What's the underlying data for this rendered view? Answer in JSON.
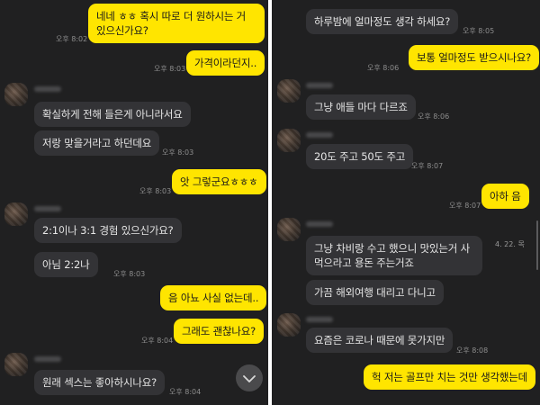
{
  "left": {
    "messages": [
      {
        "sender": "me",
        "text": "네네 ㅎㅎ 혹시 따로 더 원하시는 거 있으신가요?",
        "time": "오후 8:02"
      },
      {
        "sender": "me",
        "text": "가격이라던지..",
        "time": "오후 8:03"
      },
      {
        "sender": "other",
        "text": "확실하게 전해 들은게 아니라서요"
      },
      {
        "sender": "other",
        "text": "저랑 맞을거라고 하던데요",
        "time": "오후 8:03"
      },
      {
        "sender": "me",
        "text": "앗 그렇군요ㅎㅎㅎ",
        "time": "오후 8:03"
      },
      {
        "sender": "other",
        "text": "2:1이나 3:1 경험 있으신가요?"
      },
      {
        "sender": "other",
        "text": "아님  2:2나",
        "time": "오후 8:03"
      },
      {
        "sender": "me",
        "text": "음 아뇨 사실 없는데..",
        "time": ""
      },
      {
        "sender": "me",
        "text": "그래도 괜찮나요?",
        "time": "오후 8:04"
      },
      {
        "sender": "other",
        "text": "원래 섹스는 좋아하시나요?",
        "time": "오후 8:04"
      }
    ]
  },
  "right": {
    "messages": [
      {
        "sender": "other",
        "text": "하루밤에 얼마정도 생각 하세요?",
        "time": "오후 8:05"
      },
      {
        "sender": "me",
        "text": "보통 얼마정도 받으시나요?",
        "time": "오후 8:06"
      },
      {
        "sender": "other",
        "text": "그냥 애들 마다 다르죠",
        "time": "오후 8:06"
      },
      {
        "sender": "other",
        "text": "20도 주고 50도 주고",
        "time": "오후 8:07"
      },
      {
        "sender": "me",
        "text": "아하 음",
        "time": "오후 8:07"
      },
      {
        "sender": "other",
        "text": "그냥 차비랑  수고 했으니  맛있는거 사먹으라고 용돈 주는거죠"
      },
      {
        "sender": "other",
        "text": "가끔 해외여행 대리고 다니고"
      },
      {
        "sender": "other",
        "text": "요즘은 코로나 때문에 못가지만",
        "time": "오후 8:08"
      },
      {
        "sender": "me",
        "text": "헉 저는 골프만 치는 것만 생각했는데"
      }
    ],
    "date_indicator": "4. 22. 목"
  },
  "icons": {
    "scroll_down": "chevron-down-icon",
    "avatar": "blurred-profile-avatar"
  },
  "colors": {
    "background": "#202021",
    "my_bubble": "#ffe500",
    "their_bubble": "#333336",
    "timestamp": "#8d8d8d"
  }
}
